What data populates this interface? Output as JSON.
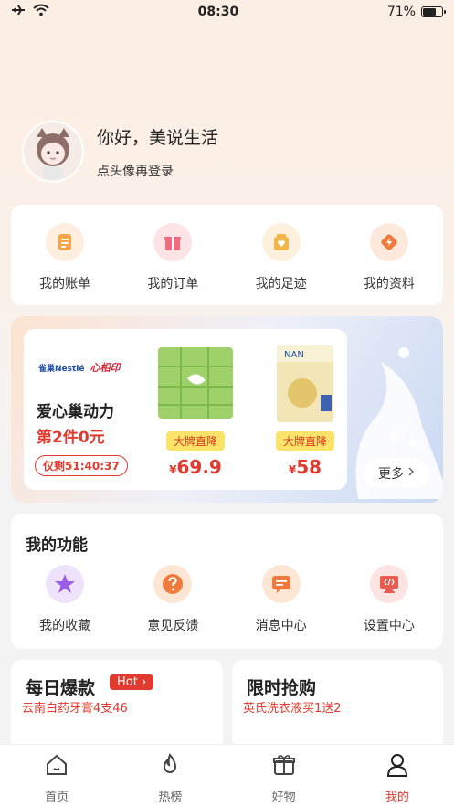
{
  "status": {
    "time": "08:30",
    "battery": "71%",
    "battery_level": 0.71
  },
  "profile": {
    "greeting": "你好，美说生活",
    "login_hint": "点头像再登录"
  },
  "quick": [
    {
      "label": "我的账单",
      "icon": "bill-icon"
    },
    {
      "label": "我的订单",
      "icon": "gift-order-icon"
    },
    {
      "label": "我的足迹",
      "icon": "footprint-icon"
    },
    {
      "label": "我的资料",
      "icon": "profile-tag-icon"
    }
  ],
  "promo": {
    "brands": [
      "雀巢Nestlé",
      "心相印"
    ],
    "title": "爱心巢动力",
    "subtitle": "第2件0元",
    "countdown": "仅剩51:40:37",
    "products": [
      {
        "tag": "大牌直降",
        "currency": "¥",
        "price": "69.9"
      },
      {
        "tag": "大牌直降",
        "currency": "¥",
        "price": "58"
      }
    ],
    "more": "更多"
  },
  "functions": {
    "title": "我的功能",
    "items": [
      {
        "label": "我的收藏",
        "icon": "star-icon"
      },
      {
        "label": "意见反馈",
        "icon": "question-icon"
      },
      {
        "label": "消息中心",
        "icon": "message-icon"
      },
      {
        "label": "设置中心",
        "icon": "settings-monitor-icon"
      }
    ]
  },
  "bottom": {
    "left": {
      "title": "每日爆款",
      "badge": "Hot",
      "sub": "云南白药牙膏4支46"
    },
    "right": {
      "title": "限时抢购",
      "sub": "英氏洗衣液买1送2"
    }
  },
  "tabs": [
    {
      "label": "首页",
      "icon": "home-icon"
    },
    {
      "label": "热榜",
      "icon": "flame-icon"
    },
    {
      "label": "好物",
      "icon": "gift-icon"
    },
    {
      "label": "我的",
      "icon": "user-icon",
      "active": true
    }
  ],
  "colors": {
    "accent": "#e33a2f",
    "tag_bg": "#fbe36a"
  }
}
